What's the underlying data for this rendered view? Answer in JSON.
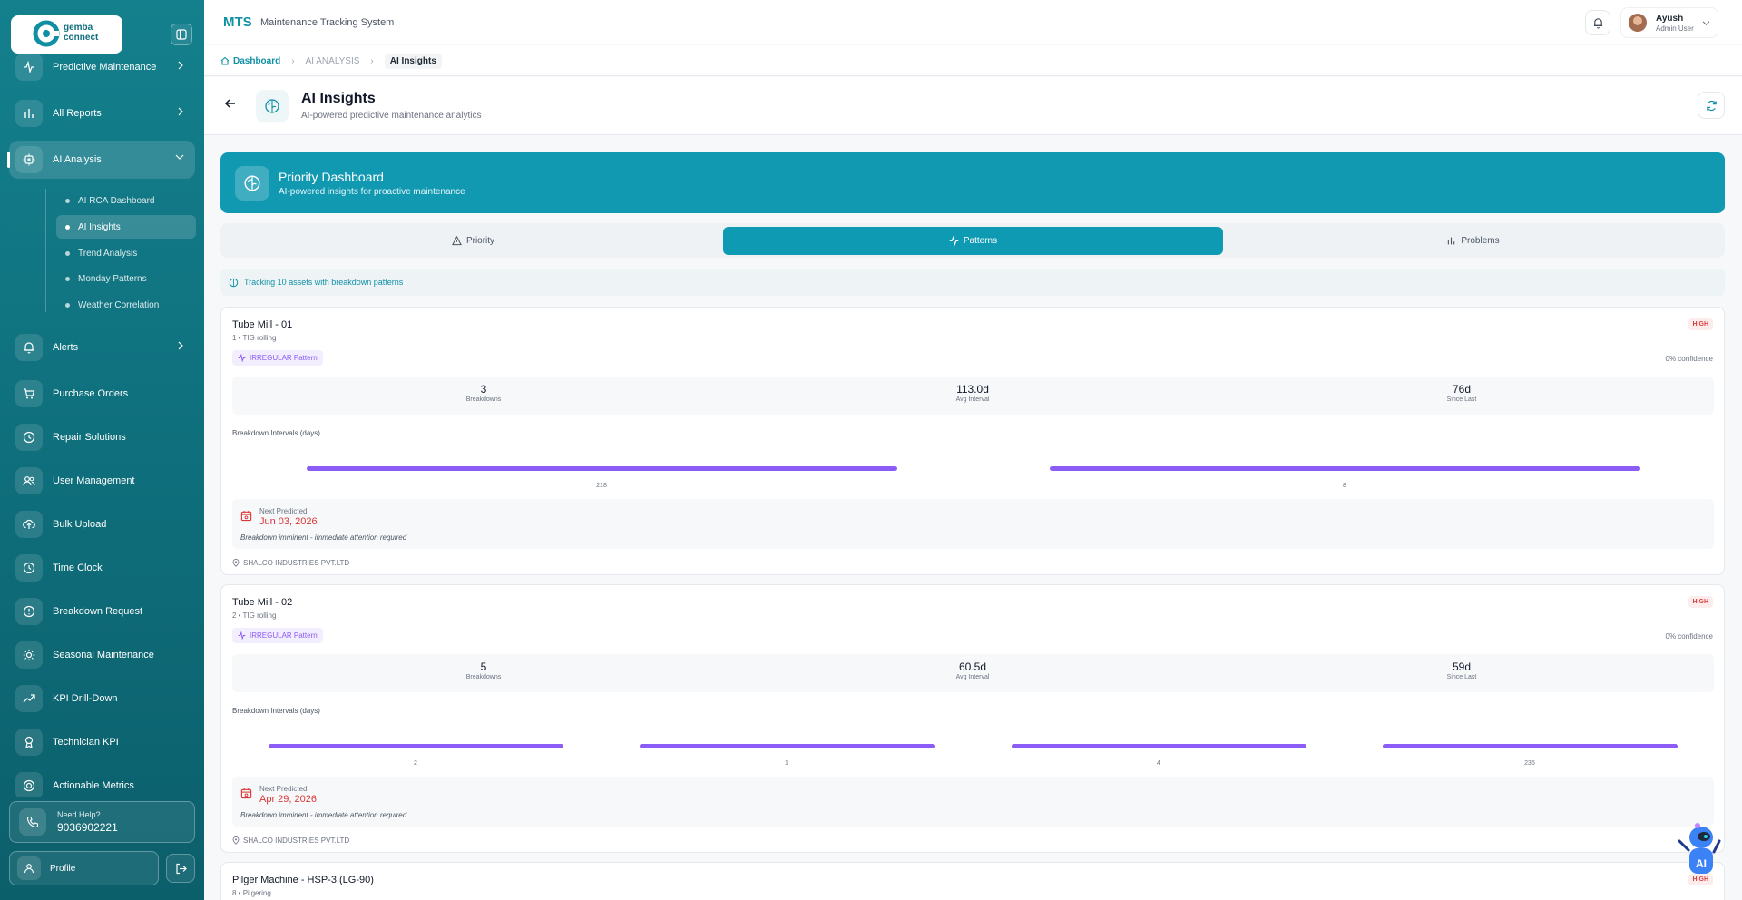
{
  "logo": {
    "line1": "gemba",
    "line2": "connect"
  },
  "sidebar": {
    "items": [
      {
        "label": "Predictive Maintenance",
        "icon": "activity-icon",
        "chevron": true
      },
      {
        "label": "All Reports",
        "icon": "bar-chart-icon",
        "chevron": true
      },
      {
        "label": "AI Analysis",
        "icon": "cpu-icon",
        "chevron": true,
        "active": true
      },
      {
        "label": "Alerts",
        "icon": "bell-icon",
        "chevron": true
      },
      {
        "label": "Purchase Orders",
        "icon": "cart-icon"
      },
      {
        "label": "Repair Solutions",
        "icon": "clock-icon"
      },
      {
        "label": "User Management",
        "icon": "users-icon"
      },
      {
        "label": "Bulk Upload",
        "icon": "upload-icon"
      },
      {
        "label": "Time Clock",
        "icon": "clock-icon"
      },
      {
        "label": "Breakdown Request",
        "icon": "alert-circle-icon"
      },
      {
        "label": "Seasonal Maintenance",
        "icon": "sun-icon"
      },
      {
        "label": "KPI Drill-Down",
        "icon": "trend-up-icon"
      },
      {
        "label": "Technician KPI",
        "icon": "award-icon"
      },
      {
        "label": "Actionable Metrics",
        "icon": "target-icon"
      }
    ],
    "sub_items": [
      {
        "label": "AI RCA Dashboard"
      },
      {
        "label": "AI Insights",
        "active": true
      },
      {
        "label": "Trend Analysis"
      },
      {
        "label": "Monday Patterns"
      },
      {
        "label": "Weather Correlation"
      }
    ],
    "help": {
      "title": "Need Help?",
      "phone": "9036902221"
    },
    "profile_label": "Profile"
  },
  "topbar": {
    "brand": "MTS",
    "subtitle": "Maintenance Tracking System",
    "user": {
      "name": "Ayush",
      "role": "Admin User"
    }
  },
  "breadcrumb": {
    "home": "Dashboard",
    "mid": "AI ANALYSIS",
    "current": "AI Insights"
  },
  "page": {
    "title": "AI Insights",
    "subtitle": "AI-powered predictive maintenance analytics"
  },
  "banner": {
    "title": "Priority Dashboard",
    "subtitle": "AI-powered insights for proactive maintenance"
  },
  "tabs": [
    {
      "label": "Priority",
      "icon": "warning-icon"
    },
    {
      "label": "Patterns",
      "icon": "activity-icon",
      "active": true
    },
    {
      "label": "Problems",
      "icon": "bar-chart-icon"
    }
  ],
  "tracking_text": "Tracking 10 assets with breakdown patterns",
  "cards": [
    {
      "title": "Tube Mill - 01",
      "sub": "1 • TIG rolling",
      "badge": "HIGH",
      "pattern": "IRREGULAR Pattern",
      "confidence": "0% confidence",
      "stats": [
        {
          "value": "3",
          "label": "Breakdowns"
        },
        {
          "value": "113.0d",
          "label": "Avg Interval"
        },
        {
          "value": "76d",
          "label": "Since Last"
        }
      ],
      "intervals_label": "Breakdown Intervals (days)",
      "intervals": [
        "218",
        "8"
      ],
      "pred_label": "Next Predicted",
      "pred_date": "Jun 03, 2026",
      "pred_note": "Breakdown imminent - immediate attention required",
      "location": "SHALCO INDUSTRIES PVT.LTD"
    },
    {
      "title": "Tube Mill - 02",
      "sub": "2 • TIG rolling",
      "badge": "HIGH",
      "pattern": "IRREGULAR Pattern",
      "confidence": "0% confidence",
      "stats": [
        {
          "value": "5",
          "label": "Breakdowns"
        },
        {
          "value": "60.5d",
          "label": "Avg Interval"
        },
        {
          "value": "59d",
          "label": "Since Last"
        }
      ],
      "intervals_label": "Breakdown Intervals (days)",
      "intervals": [
        "2",
        "1",
        "4",
        "235"
      ],
      "pred_label": "Next Predicted",
      "pred_date": "Apr 29, 2026",
      "pred_note": "Breakdown imminent - immediate attention required",
      "location": "SHALCO INDUSTRIES PVT.LTD"
    },
    {
      "title": "Pilger Machine - HSP-3 (LG-90)",
      "sub": "8 • Pilgering",
      "badge": "HIGH"
    }
  ],
  "ai_bot_label": "AI",
  "colors": {
    "primary": "#0e9ab3",
    "sidebar": "#0f6f7c",
    "danger": "#dc3535",
    "bar": "#8b5cf6"
  }
}
